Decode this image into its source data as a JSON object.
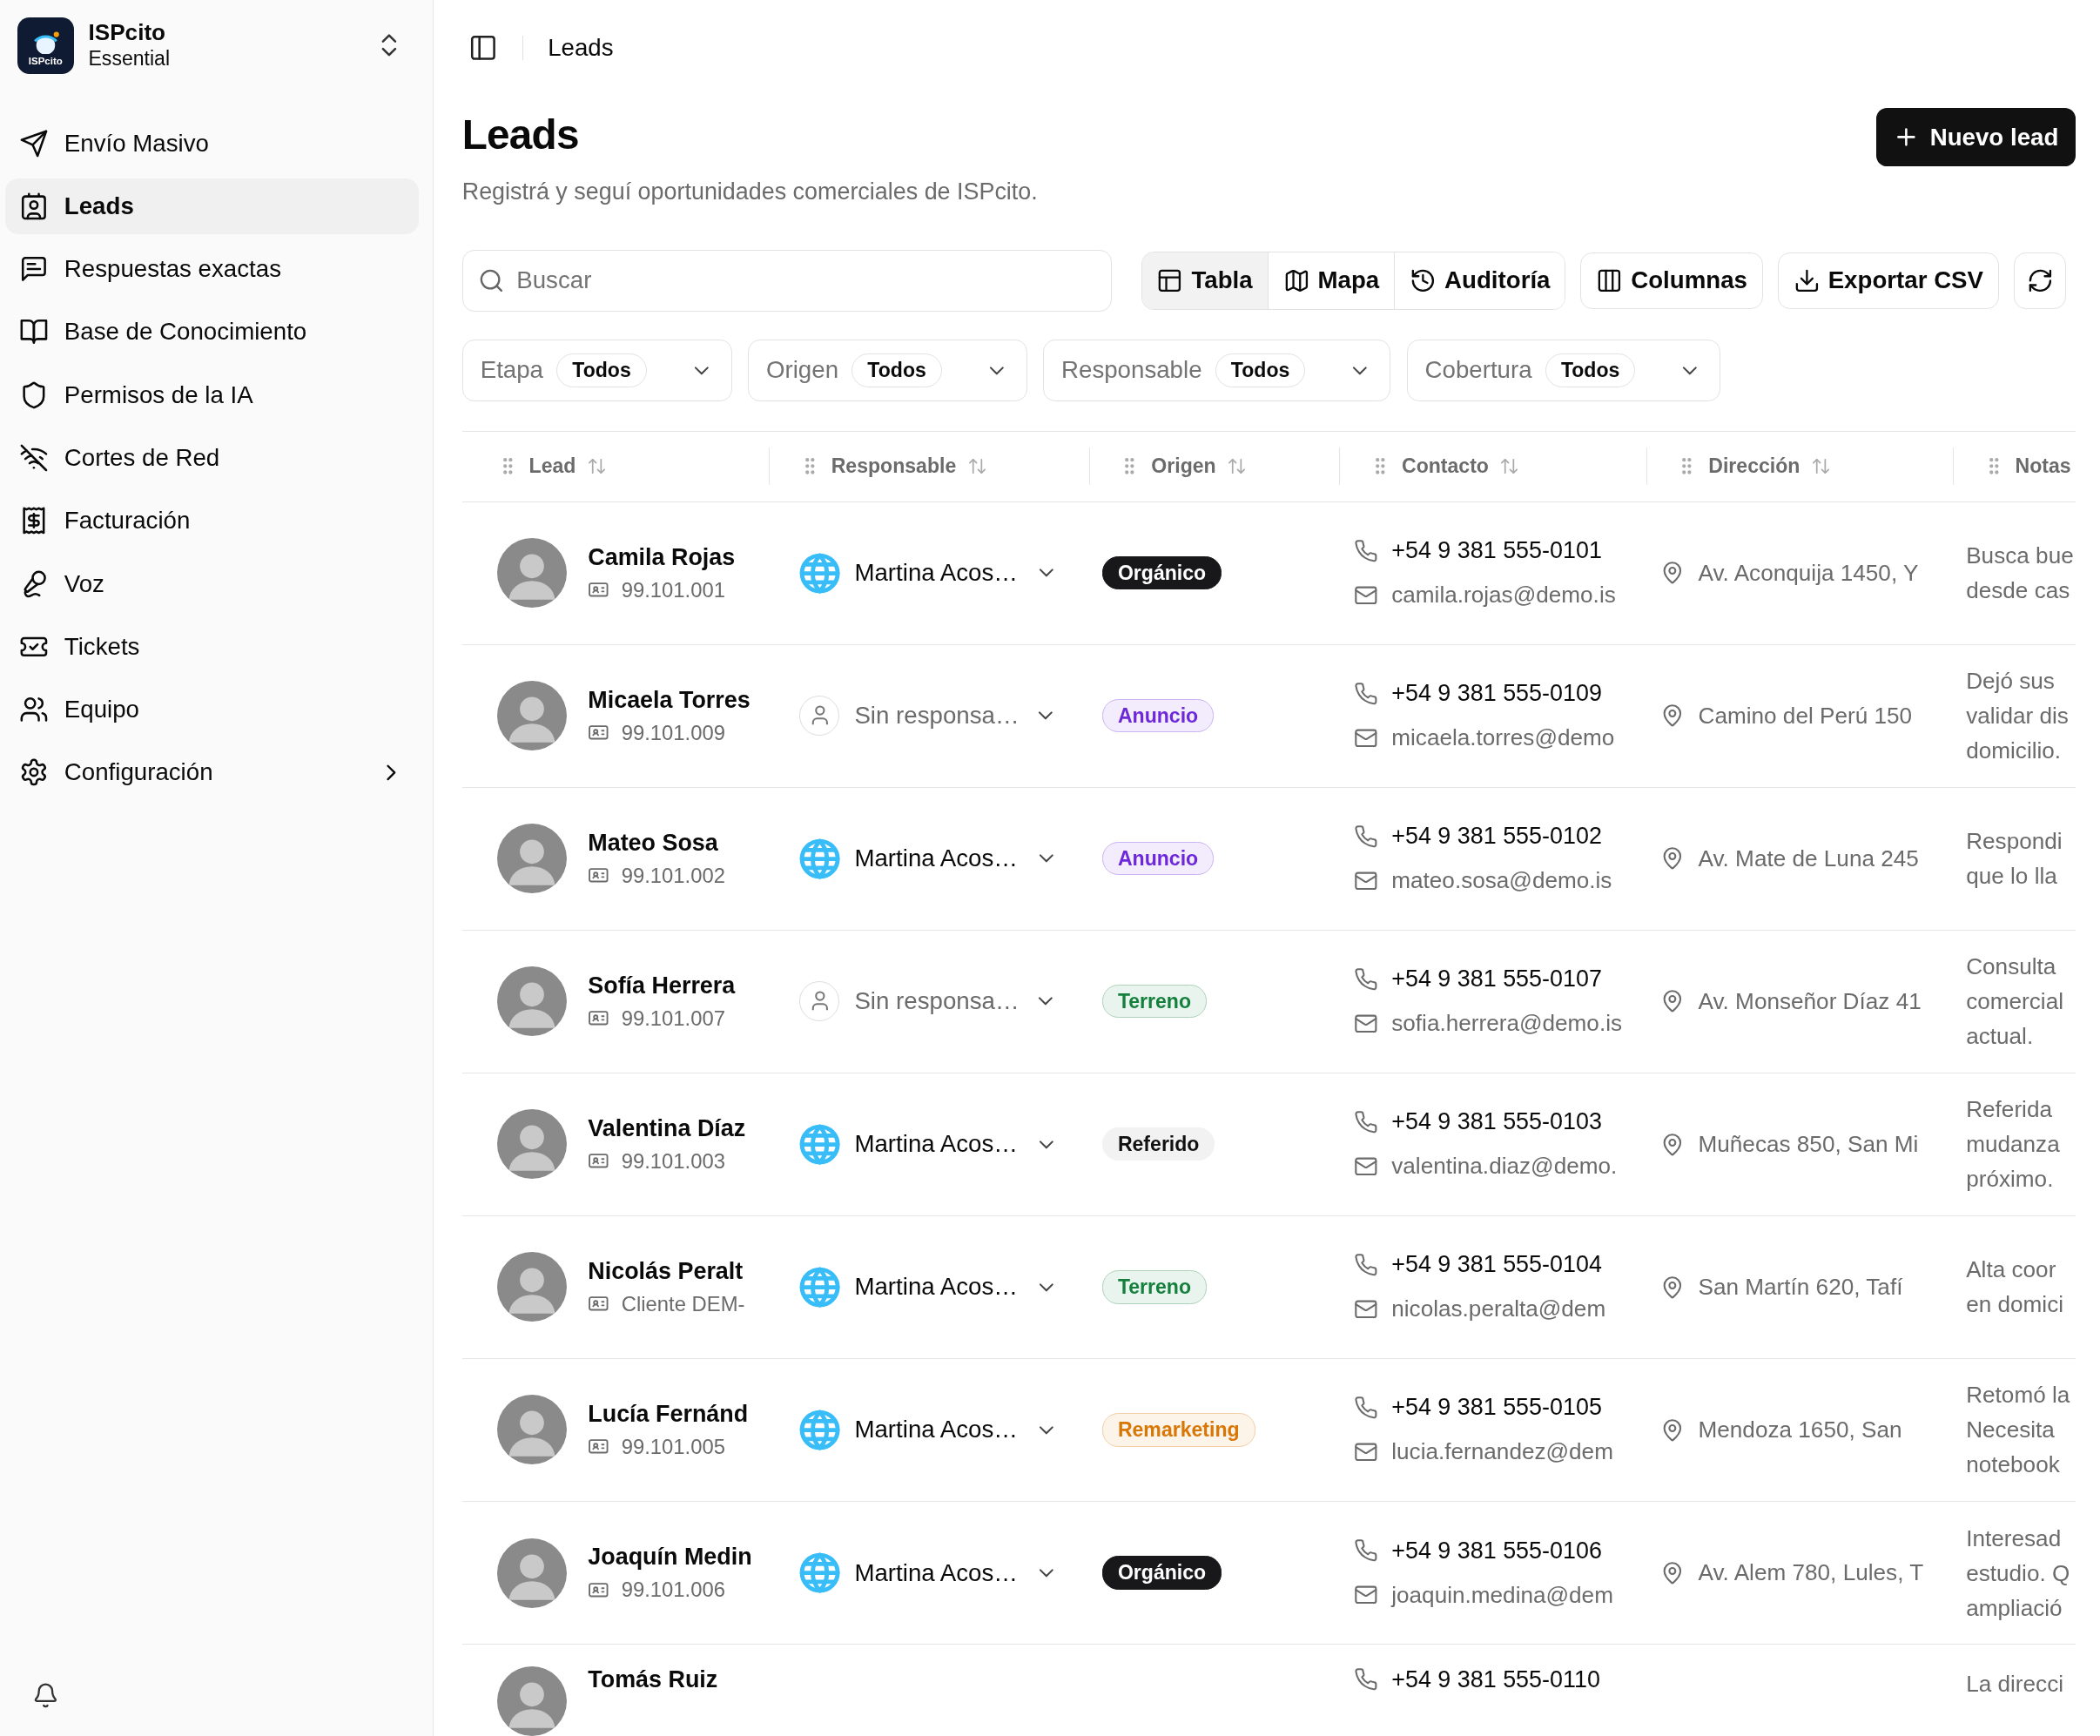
{
  "sidebar": {
    "brand": {
      "logo_text": "ISPcito",
      "name": "ISPcito",
      "plan": "Essential"
    },
    "items": [
      {
        "label": "Envío Masivo",
        "selected": false,
        "has_submenu": false
      },
      {
        "label": "Leads",
        "selected": true,
        "has_submenu": false
      },
      {
        "label": "Respuestas exactas",
        "selected": false,
        "has_submenu": false
      },
      {
        "label": "Base de Conocimiento",
        "selected": false,
        "has_submenu": false
      },
      {
        "label": "Permisos de la IA",
        "selected": false,
        "has_submenu": false
      },
      {
        "label": "Cortes de Red",
        "selected": false,
        "has_submenu": false
      },
      {
        "label": "Facturación",
        "selected": false,
        "has_submenu": false
      },
      {
        "label": "Voz",
        "selected": false,
        "has_submenu": false
      },
      {
        "label": "Tickets",
        "selected": false,
        "has_submenu": false
      },
      {
        "label": "Equipo",
        "selected": false,
        "has_submenu": false
      },
      {
        "label": "Configuración",
        "selected": false,
        "has_submenu": true
      }
    ]
  },
  "breadcrumb": "Leads",
  "page": {
    "title": "Leads",
    "subtitle": "Registrá y seguí oportunidades comerciales de ISPcito.",
    "primary_button": "Nuevo lead"
  },
  "toolbar": {
    "search": {
      "placeholder": "Buscar"
    },
    "views": [
      {
        "label": "Tabla",
        "selected": true
      },
      {
        "label": "Mapa",
        "selected": false
      },
      {
        "label": "Auditoría",
        "selected": false
      }
    ],
    "buttons": [
      "Columnas",
      "Exportar CSV"
    ]
  },
  "filters": [
    {
      "label": "Etapa",
      "value": "Todos"
    },
    {
      "label": "Origen",
      "value": "Todos"
    },
    {
      "label": "Responsable",
      "value": "Todos"
    },
    {
      "label": "Cobertura",
      "value": "Todos"
    }
  ],
  "table": {
    "columns": [
      "Lead",
      "Responsable",
      "Origen",
      "Contacto",
      "Dirección",
      "Notas"
    ],
    "rows": [
      {
        "name": "Camila Rojas",
        "client_id": "99.101.001",
        "owner": {
          "name": "Martina Acos…",
          "assigned": true
        },
        "origin": {
          "label": "Orgánico",
          "kind": "solid",
          "color": "#18181b"
        },
        "phone": "+54 9 381 555-0101",
        "email": "camila.rojas@demo.is",
        "address": "Av. Aconquija 1450, Y",
        "notes": "Busca bue\ndesde cas"
      },
      {
        "name": "Micaela Torres",
        "client_id": "99.101.009",
        "owner": {
          "name": "Sin responsa…",
          "assigned": false
        },
        "origin": {
          "label": "Anuncio",
          "kind": "tinted",
          "color": "#6d28d9"
        },
        "phone": "+54 9 381 555-0109",
        "email": "micaela.torres@demo",
        "address": "Camino del Perú 150",
        "notes": "Dejó sus\nvalidar dis\ndomicilio."
      },
      {
        "name": "Mateo Sosa",
        "client_id": "99.101.002",
        "owner": {
          "name": "Martina Acos…",
          "assigned": true
        },
        "origin": {
          "label": "Anuncio",
          "kind": "tinted",
          "color": "#6d28d9"
        },
        "phone": "+54 9 381 555-0102",
        "email": "mateo.sosa@demo.is",
        "address": "Av. Mate de Luna 245",
        "notes": "Respondi\nque lo lla"
      },
      {
        "name": "Sofía Herrera",
        "client_id": "99.101.007",
        "owner": {
          "name": "Sin responsa…",
          "assigned": false
        },
        "origin": {
          "label": "Terreno",
          "kind": "tinted",
          "color": "#15803d"
        },
        "phone": "+54 9 381 555-0107",
        "email": "sofia.herrera@demo.is",
        "address": "Av. Monseñor Díaz 41",
        "notes": "Consulta\ncomercial\nactual."
      },
      {
        "name": "Valentina Díaz",
        "client_id": "99.101.003",
        "owner": {
          "name": "Martina Acos…",
          "assigned": true
        },
        "origin": {
          "label": "Referido",
          "kind": "plain"
        },
        "phone": "+54 9 381 555-0103",
        "email": "valentina.diaz@demo.",
        "address": "Muñecas 850, San Mi",
        "notes": "Referida\nmudanza\npróximo."
      },
      {
        "name": "Nicolás Peralt",
        "client_id": "Cliente DEM-",
        "owner": {
          "name": "Martina Acos…",
          "assigned": true
        },
        "origin": {
          "label": "Terreno",
          "kind": "tinted",
          "color": "#15803d"
        },
        "phone": "+54 9 381 555-0104",
        "email": "nicolas.peralta@dem",
        "address": "San Martín 620, Tafí",
        "notes": "Alta coor\nen domici"
      },
      {
        "name": "Lucía Fernánd",
        "client_id": "99.101.005",
        "owner": {
          "name": "Martina Acos…",
          "assigned": true
        },
        "origin": {
          "label": "Remarketing",
          "kind": "tinted",
          "color": "#d97706"
        },
        "phone": "+54 9 381 555-0105",
        "email": "lucia.fernandez@dem",
        "address": "Mendoza 1650, San",
        "notes": "Retomó la\nNecesita\nnotebook"
      },
      {
        "name": "Joaquín Medin",
        "client_id": "99.101.006",
        "owner": {
          "name": "Martina Acos…",
          "assigned": true
        },
        "origin": {
          "label": "Orgánico",
          "kind": "solid",
          "color": "#18181b"
        },
        "phone": "+54 9 381 555-0106",
        "email": "joaquin.medina@dem",
        "address": "Av. Alem 780, Lules, T",
        "notes": "Interesad\nestudio. Q\nampliació"
      },
      {
        "name": "Tomás Ruiz",
        "phone": "+54 9 381 555-0110",
        "notes": "La direcci"
      }
    ]
  }
}
